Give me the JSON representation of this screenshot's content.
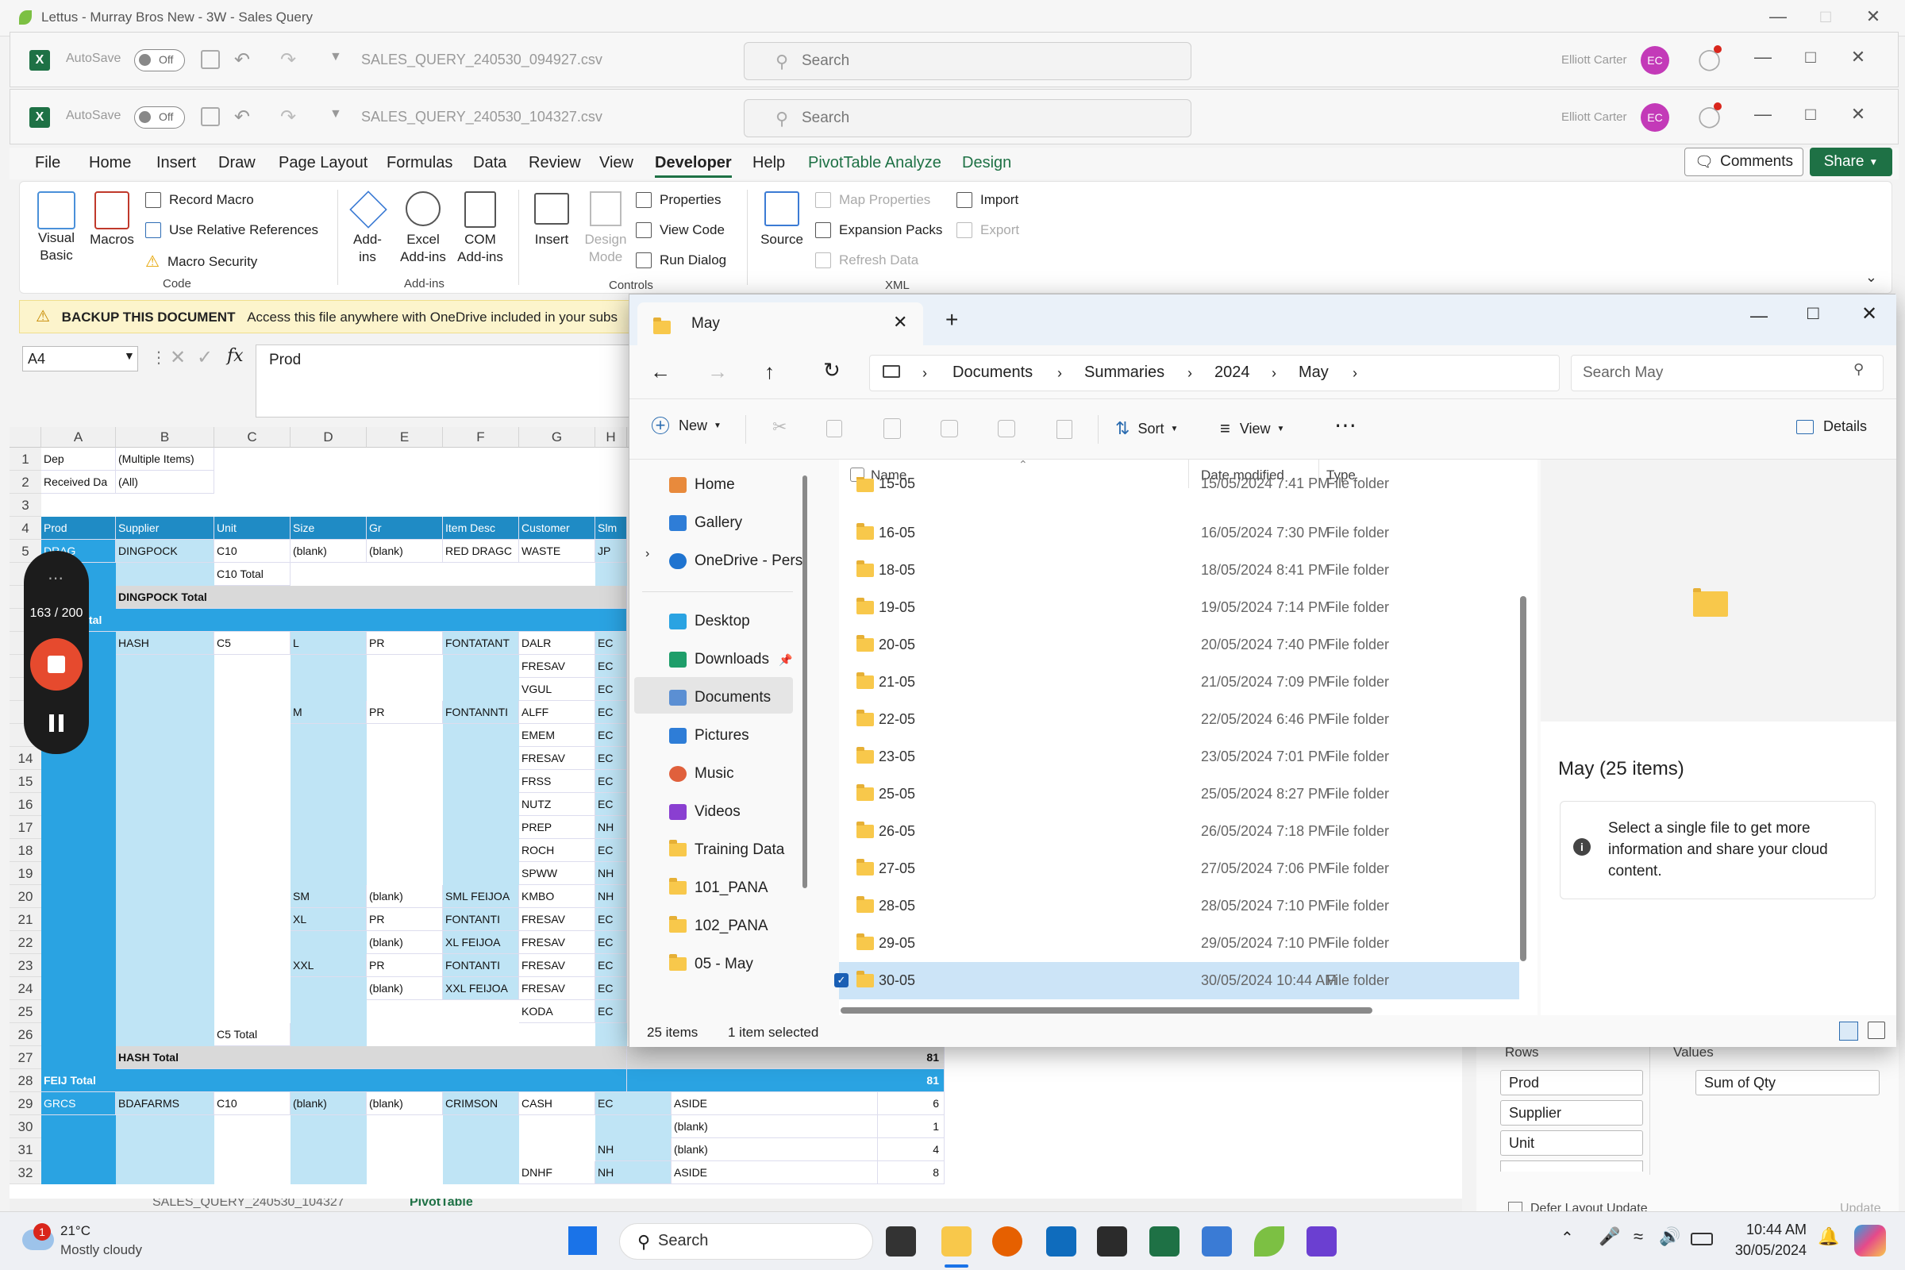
{
  "outer_window": {
    "title": "Lettus - Murray Bros New - 3W - Sales Query"
  },
  "excel_back": {
    "autosave_label": "AutoSave",
    "autosave_state": "Off",
    "filename": "SALES_QUERY_240530_094927.csv",
    "search_placeholder": "Search",
    "user_name": "Elliott Carter",
    "user_initials": "EC"
  },
  "excel_front": {
    "autosave_label": "AutoSave",
    "autosave_state": "Off",
    "filename": "SALES_QUERY_240530_104327.csv",
    "search_placeholder": "Search",
    "user_name": "Elliott Carter",
    "user_initials": "EC",
    "comments_label": "Comments",
    "share_label": "Share"
  },
  "ribbon_tabs": [
    "File",
    "Home",
    "Insert",
    "Draw",
    "Page Layout",
    "Formulas",
    "Data",
    "Review",
    "View",
    "Developer",
    "Help",
    "PivotTable Analyze",
    "Design"
  ],
  "ribbon": {
    "code": {
      "group": "Code",
      "visual_basic": "Visual Basic",
      "macros": "Macros",
      "record_macro": "Record Macro",
      "relative_refs": "Use Relative References",
      "macro_security": "Macro Security"
    },
    "addins": {
      "group": "Add-ins",
      "addins": "Add-ins",
      "excel_addins": "Excel Add-ins",
      "com_addins": "COM Add-ins"
    },
    "controls": {
      "group": "Controls",
      "insert": "Insert",
      "design_mode": "Design Mode",
      "properties": "Properties",
      "view_code": "View Code",
      "run_dialog": "Run Dialog"
    },
    "xml": {
      "group": "XML",
      "source": "Source",
      "map_properties": "Map Properties",
      "expansion_packs": "Expansion Packs",
      "refresh_data": "Refresh Data",
      "import": "Import",
      "export": "Export"
    }
  },
  "notice": {
    "title": "BACKUP THIS DOCUMENT",
    "text": "Access this file anywhere with OneDrive included in your subs"
  },
  "formula_bar": {
    "name_box": "A4",
    "fx": "fx",
    "content": "Prod"
  },
  "grid": {
    "columns": [
      "A",
      "B",
      "C",
      "D",
      "E",
      "F",
      "G",
      "H"
    ],
    "rows": [
      "1",
      "2",
      "3",
      "4",
      "5",
      "",
      "",
      "",
      "",
      "",
      "",
      "",
      "",
      "14",
      "15",
      "16",
      "17",
      "18",
      "19",
      "20",
      "21",
      "22",
      "23",
      "24",
      "25",
      "26",
      "27",
      "28",
      "29",
      "30",
      "31",
      "32"
    ],
    "filter1_label": "Dep",
    "filter1_value": "(Multiple Items)",
    "filter2_label": "Received Da",
    "filter2_value": "(All)",
    "headers": [
      "Prod",
      "Supplier",
      "Unit",
      "Size",
      "Gr",
      "Item Desc",
      "Customer",
      "Slm"
    ],
    "cells": {
      "r5": [
        "DRAG",
        "DINGPOCK",
        "C10",
        "(blank)",
        "(blank)",
        "RED DRAGC",
        "WASTE",
        "JP"
      ],
      "c10_total": "C10 Total",
      "dingpock_total": "DINGPOCK Total",
      "tal": "tal",
      "hash": "HASH",
      "c5": "C5",
      "l": "L",
      "pr": "PR",
      "fontatant": "FONTATANT",
      "customers_l": [
        "DALR",
        "FRESAV",
        "VGUL"
      ],
      "m": "M",
      "fontannt": "FONTANNTI",
      "customers_m": [
        "ALFF",
        "EMEM",
        "FRESAV",
        "FRSS",
        "NUTZ",
        "PREP",
        "ROCH",
        "SPWW"
      ],
      "slm_m": [
        "EC",
        "EC",
        "EC",
        "EC",
        "EC",
        "NH",
        "EC",
        "NH"
      ],
      "slm_l": [
        "EC",
        "EC",
        "EC"
      ],
      "sm": "SM",
      "blank": "(blank)",
      "sml_feijoa": "SML FEIJOA",
      "kmbo": "KMBO",
      "xl": "XL",
      "fontanti": "FONTANTI",
      "xl_feijoa": "XL FEIJOA",
      "xxl": "XXL",
      "xxl_feijoa": "XXL FEIJOA",
      "customers_low": [
        "KMBO",
        "FRESAV",
        "FRESAV",
        "FRESAV",
        "FRESAV",
        "KODA"
      ],
      "slm_low": [
        "NH",
        "EC",
        "EC",
        "EC",
        "EC",
        "EC"
      ],
      "c5_total": "C5 Total",
      "hash_total": "HASH Total",
      "hash_total_val": "81",
      "feu_total": "FEIJ Total",
      "feu_total_val": "81",
      "r29": [
        "GRCS",
        "BDAFARMS",
        "C10",
        "(blank)",
        "(blank)",
        "CRIMSON",
        "CASH",
        "EC",
        "ASIDE",
        "6"
      ],
      "r30": [
        "(blank)",
        "1"
      ],
      "r31": [
        "NH",
        "(blank)",
        "4"
      ],
      "r32": [
        "DNHF",
        "NH",
        "ASIDE",
        "8"
      ]
    },
    "sheet_tabs": [
      "SALES_QUERY_240530_104327",
      "PivotTable"
    ]
  },
  "recorder": {
    "counter": "163 / 200"
  },
  "explorer": {
    "tab_title": "May",
    "breadcrumbs": [
      "Documents",
      "Summaries",
      "2024",
      "May"
    ],
    "search_placeholder": "Search May",
    "cmd": {
      "new": "New",
      "sort": "Sort",
      "view": "View",
      "details": "Details"
    },
    "nav": [
      "Home",
      "Gallery",
      "OneDrive - Perso",
      "Desktop",
      "Downloads",
      "Documents",
      "Pictures",
      "Music",
      "Videos",
      "Training Data",
      "101_PANA",
      "102_PANA",
      "05 - May"
    ],
    "columns": {
      "name": "Name",
      "date": "Date modified",
      "type": "Type"
    },
    "files": [
      {
        "name": "15-05",
        "date": "15/05/2024 7:41 PM",
        "type": "File folder"
      },
      {
        "name": "16-05",
        "date": "16/05/2024 7:30 PM",
        "type": "File folder"
      },
      {
        "name": "18-05",
        "date": "18/05/2024 8:41 PM",
        "type": "File folder"
      },
      {
        "name": "19-05",
        "date": "19/05/2024 7:14 PM",
        "type": "File folder"
      },
      {
        "name": "20-05",
        "date": "20/05/2024 7:40 PM",
        "type": "File folder"
      },
      {
        "name": "21-05",
        "date": "21/05/2024 7:09 PM",
        "type": "File folder"
      },
      {
        "name": "22-05",
        "date": "22/05/2024 6:46 PM",
        "type": "File folder"
      },
      {
        "name": "23-05",
        "date": "23/05/2024 7:01 PM",
        "type": "File folder"
      },
      {
        "name": "25-05",
        "date": "25/05/2024 8:27 PM",
        "type": "File folder"
      },
      {
        "name": "26-05",
        "date": "26/05/2024 7:18 PM",
        "type": "File folder"
      },
      {
        "name": "27-05",
        "date": "27/05/2024 7:06 PM",
        "type": "File folder"
      },
      {
        "name": "28-05",
        "date": "28/05/2024 7:10 PM",
        "type": "File folder"
      },
      {
        "name": "29-05",
        "date": "29/05/2024 7:10 PM",
        "type": "File folder"
      },
      {
        "name": "30-05",
        "date": "30/05/2024 10:44 AM",
        "type": "File folder"
      }
    ],
    "details_title": "May (25 items)",
    "details_info": "Select a single file to get more information and share your cloud content.",
    "status_count": "25 items",
    "status_selected": "1 item selected"
  },
  "pivot_pane": {
    "rows_label": "Rows",
    "values_label": "Values",
    "rows": [
      "Prod",
      "Supplier",
      "Unit"
    ],
    "values": [
      "Sum of Qty"
    ],
    "defer_label": "Defer Layout Update",
    "update_label": "Update"
  },
  "taskbar": {
    "weather_temp": "21°C",
    "weather_desc": "Mostly cloudy",
    "weather_badge": "1",
    "search_label": "Search",
    "time": "10:44 AM",
    "date": "30/05/2024"
  }
}
